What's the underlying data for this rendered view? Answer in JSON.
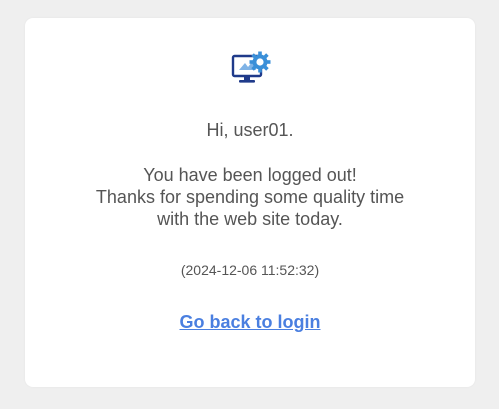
{
  "logo": {
    "icon": "computer-gear-icon",
    "color_screen": "#1f3a8a",
    "color_gear": "#3a8fd8"
  },
  "greeting": "Hi, user01.",
  "message_lines": [
    "You have been logged out!",
    "Thanks for spending some quality time",
    "with the web site today."
  ],
  "timestamp": "(2024-12-06 11:52:32)",
  "login_link": {
    "label": "Go back to login",
    "color": "#4a7fe0"
  }
}
